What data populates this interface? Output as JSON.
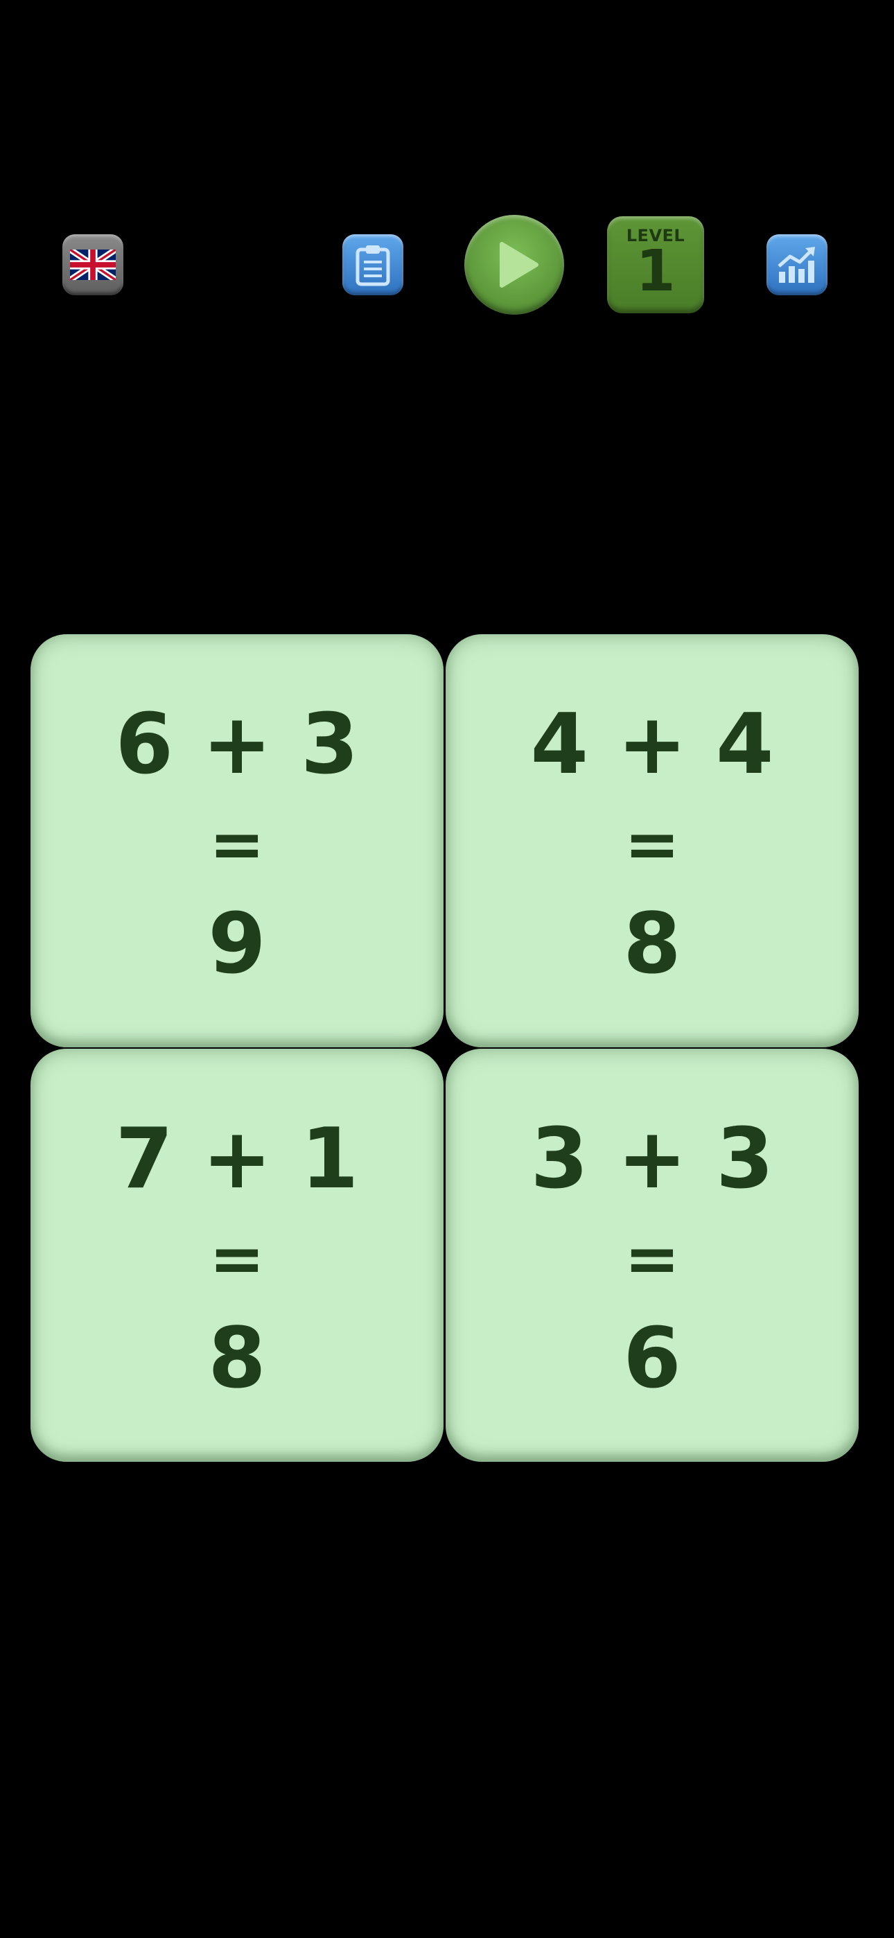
{
  "toolbar": {
    "language_icon": "uk-flag-icon",
    "clipboard_icon": "clipboard-icon",
    "play_icon": "play-icon",
    "stats_icon": "chart-up-icon",
    "level_label": "LEVEL",
    "level_number": "1"
  },
  "colors": {
    "background": "#000000",
    "card": "#c8eec8",
    "card_text": "#1f3e1c",
    "play_green": "#5f9a3c",
    "level_green": "#4a7d28",
    "button_blue": "#3f86d3"
  },
  "cards": [
    {
      "equation": "6 + 3",
      "equals": "=",
      "answer": "9"
    },
    {
      "equation": "4 + 4",
      "equals": "=",
      "answer": "8"
    },
    {
      "equation": "7 + 1",
      "equals": "=",
      "answer": "8"
    },
    {
      "equation": "3 + 3",
      "equals": "=",
      "answer": "6"
    }
  ]
}
